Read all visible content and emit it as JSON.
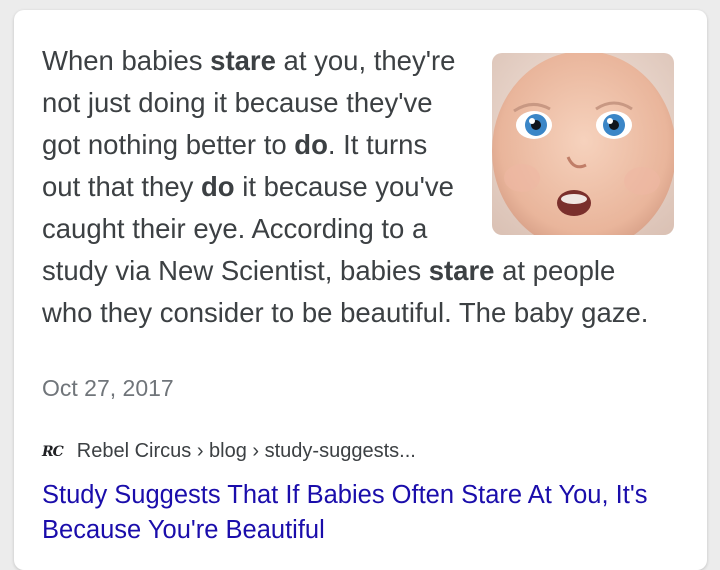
{
  "snippet": {
    "t1": "When babies ",
    "b1": "stare",
    "t2": " at you, they're not just doing it because they've got nothing better to ",
    "b2": "do",
    "t3": ". It turns out that they ",
    "b3": "do",
    "t4": " it because you've caught their eye. According to a study via New Scientist, babies ",
    "b4": "stare",
    "t5": " at people who they consider to be beautiful. The baby gaze."
  },
  "date": "Oct 27, 2017",
  "source": {
    "logo_text": "RC",
    "breadcrumb": "Rebel Circus › blog › study-suggests..."
  },
  "result": {
    "title": "Study Suggests That If Babies Often Stare At You, It's Because You're Beautiful"
  },
  "colors": {
    "link": "#1a0dab",
    "text": "#3c4043",
    "date": "#70757a"
  }
}
